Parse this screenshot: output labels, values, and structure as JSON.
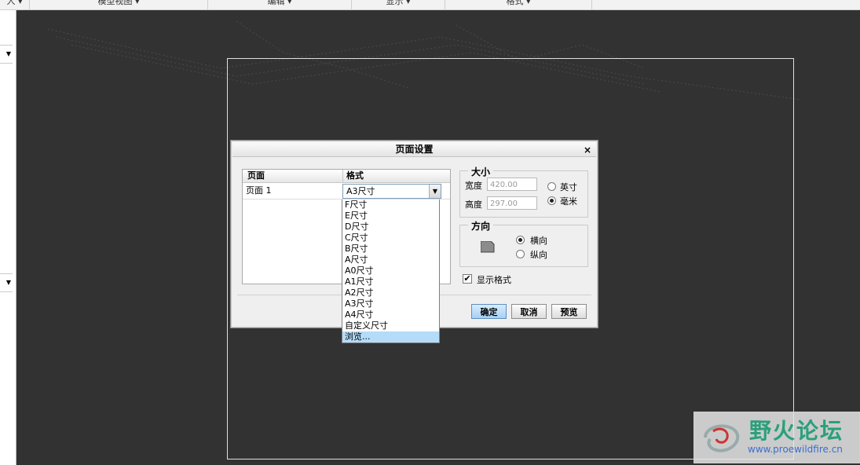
{
  "toolbar": {
    "tabs": [
      "人 ▾",
      "模型视图 ▾",
      "编辑 ▾",
      "显示 ▾",
      "格式 ▾"
    ]
  },
  "dialog": {
    "title": "页面设置",
    "close_glyph": "×",
    "table": {
      "col_page": "页面",
      "col_format": "格式",
      "row_page": "页面 1",
      "row_format": "A3尺寸"
    },
    "dropdown_options": [
      "F尺寸",
      "E尺寸",
      "D尺寸",
      "C尺寸",
      "B尺寸",
      "A尺寸",
      "A0尺寸",
      "A1尺寸",
      "A2尺寸",
      "A3尺寸",
      "A4尺寸",
      "自定义尺寸",
      "浏览..."
    ],
    "dropdown_selected": "浏览...",
    "size": {
      "legend": "大小",
      "width_label": "宽度",
      "width_value": "420.00",
      "height_label": "高度",
      "height_value": "297.00",
      "unit_inch": "英寸",
      "unit_mm": "毫米",
      "selected_unit": "毫米"
    },
    "orientation": {
      "legend": "方向",
      "landscape": "横向",
      "portrait": "纵向",
      "selected": "横向"
    },
    "show_format_label": "显示格式",
    "show_format_checked": true,
    "buttons": {
      "ok": "确定",
      "cancel": "取消",
      "preview": "预览"
    }
  },
  "watermark": {
    "title": "野火论坛",
    "url": "www.proewildfire.cn"
  },
  "colors": {
    "canvas": "#333233",
    "dropdown_highlight": "#b4dcf8",
    "watermark_green": "#2aa07a"
  }
}
